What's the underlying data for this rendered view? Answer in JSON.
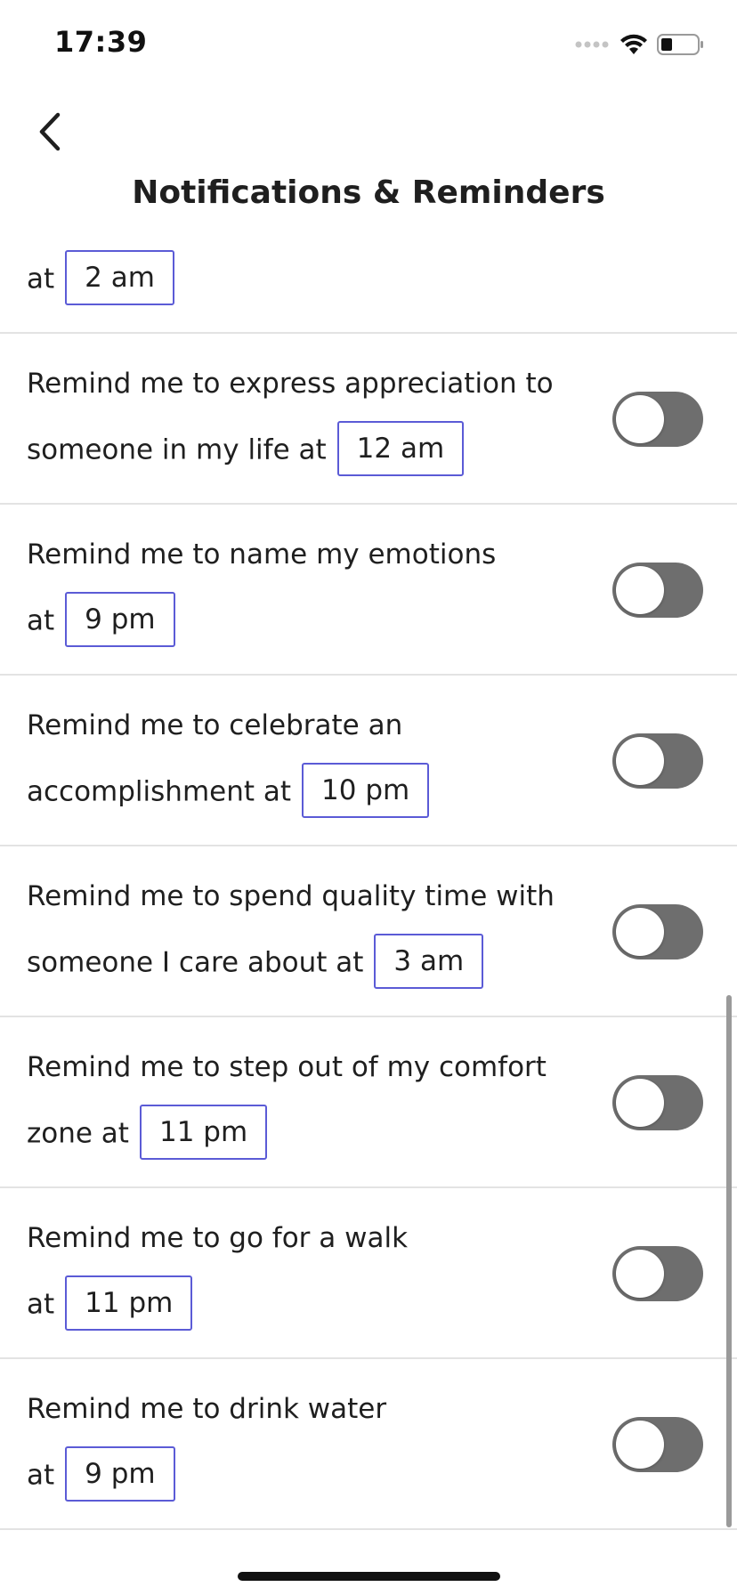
{
  "status_bar": {
    "time": "17:39",
    "signal_icon": "signal-dots-icon",
    "wifi_icon": "wifi-icon",
    "battery_icon": "battery-icon"
  },
  "header": {
    "back_icon": "chevron-left-icon",
    "title": "Notifications & Reminders"
  },
  "colors": {
    "time_box_border": "#5b5bd6",
    "toggle_off": "#6e6e6e",
    "divider": "#e3e3e3"
  },
  "reminders": [
    {
      "line1": "",
      "line2_prefix": "at",
      "time": "2 am",
      "enabled": false
    },
    {
      "line1": "Remind me to express appreciation to",
      "line2_prefix": "someone in my life at",
      "time": "12 am",
      "enabled": false
    },
    {
      "line1": "Remind me to name my emotions",
      "line2_prefix": "at",
      "time": "9 pm",
      "enabled": false
    },
    {
      "line1": "Remind me to celebrate an",
      "line2_prefix": "accomplishment at",
      "time": "10 pm",
      "enabled": false
    },
    {
      "line1": "Remind me to spend quality time with",
      "line2_prefix": "someone I care about at",
      "time": "3 am",
      "enabled": false
    },
    {
      "line1": "Remind me to step out of my comfort",
      "line2_prefix": "zone at",
      "time": "11 pm",
      "enabled": false
    },
    {
      "line1": "Remind me to go for a walk",
      "line2_prefix": "at",
      "time": "11 pm",
      "enabled": false
    },
    {
      "line1": "Remind me to drink water",
      "line2_prefix": "at",
      "time": "9 pm",
      "enabled": false
    }
  ]
}
